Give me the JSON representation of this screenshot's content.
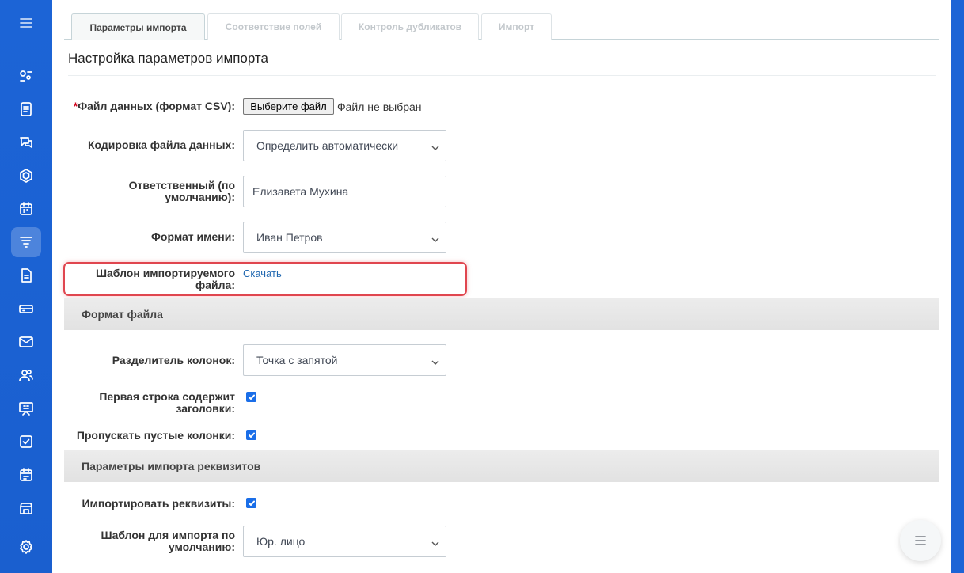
{
  "tabs": [
    {
      "label": "Параметры импорта",
      "active": true
    },
    {
      "label": "Соответствие полей",
      "active": false
    },
    {
      "label": "Контроль дубликатов",
      "active": false
    },
    {
      "label": "Импорт",
      "active": false
    }
  ],
  "page_title": "Настройка параметров импорта",
  "form": {
    "file": {
      "required_mark": "*",
      "label": "Файл данных (формат CSV):",
      "button": "Выберите файл",
      "status": "Файл не выбран"
    },
    "encoding": {
      "label": "Кодировка файла данных:",
      "value": "Определить автоматически"
    },
    "responsible": {
      "label_line1": "Ответственный (по",
      "label_line2": "умолчанию):",
      "value": "Елизавета Мухина"
    },
    "name_format": {
      "label": "Формат имени:",
      "value": "Иван Петров"
    },
    "template": {
      "label_line1": "Шаблон импортируемого",
      "label_line2": "файла:",
      "link": "Скачать"
    }
  },
  "section_file_format": {
    "title": "Формат файла",
    "separator": {
      "label": "Разделитель колонок:",
      "value": "Точка с запятой"
    },
    "first_row_headers": {
      "label_line1": "Первая строка содержит",
      "label_line2": "заголовки:",
      "checked": true
    },
    "skip_empty": {
      "label": "Пропускать пустые колонки:",
      "checked": true
    }
  },
  "section_requisites": {
    "title": "Параметры импорта реквизитов",
    "import_requisites": {
      "label": "Импортировать реквизиты:",
      "checked": true
    },
    "default_template": {
      "label_line1": "Шаблон для импорта по",
      "label_line2": "умолчанию:",
      "value": "Юр. лицо"
    }
  },
  "colors": {
    "sidebar": "#1c64d6",
    "highlight": "#e0464f",
    "link": "#1f67b0",
    "checkbox": "#1a6ee8"
  },
  "icons": {
    "sidebar": [
      "menu-icon",
      "sales-funnel-icon",
      "document-icon",
      "chat-icon",
      "hexagon-icon",
      "calendar-icon",
      "filter-icon",
      "file-icon",
      "inbox-icon",
      "mail-icon",
      "contacts-icon",
      "presentation-icon",
      "tasks-icon",
      "schedule-icon",
      "store-icon",
      "settings-icon"
    ],
    "fab": "list-icon"
  }
}
